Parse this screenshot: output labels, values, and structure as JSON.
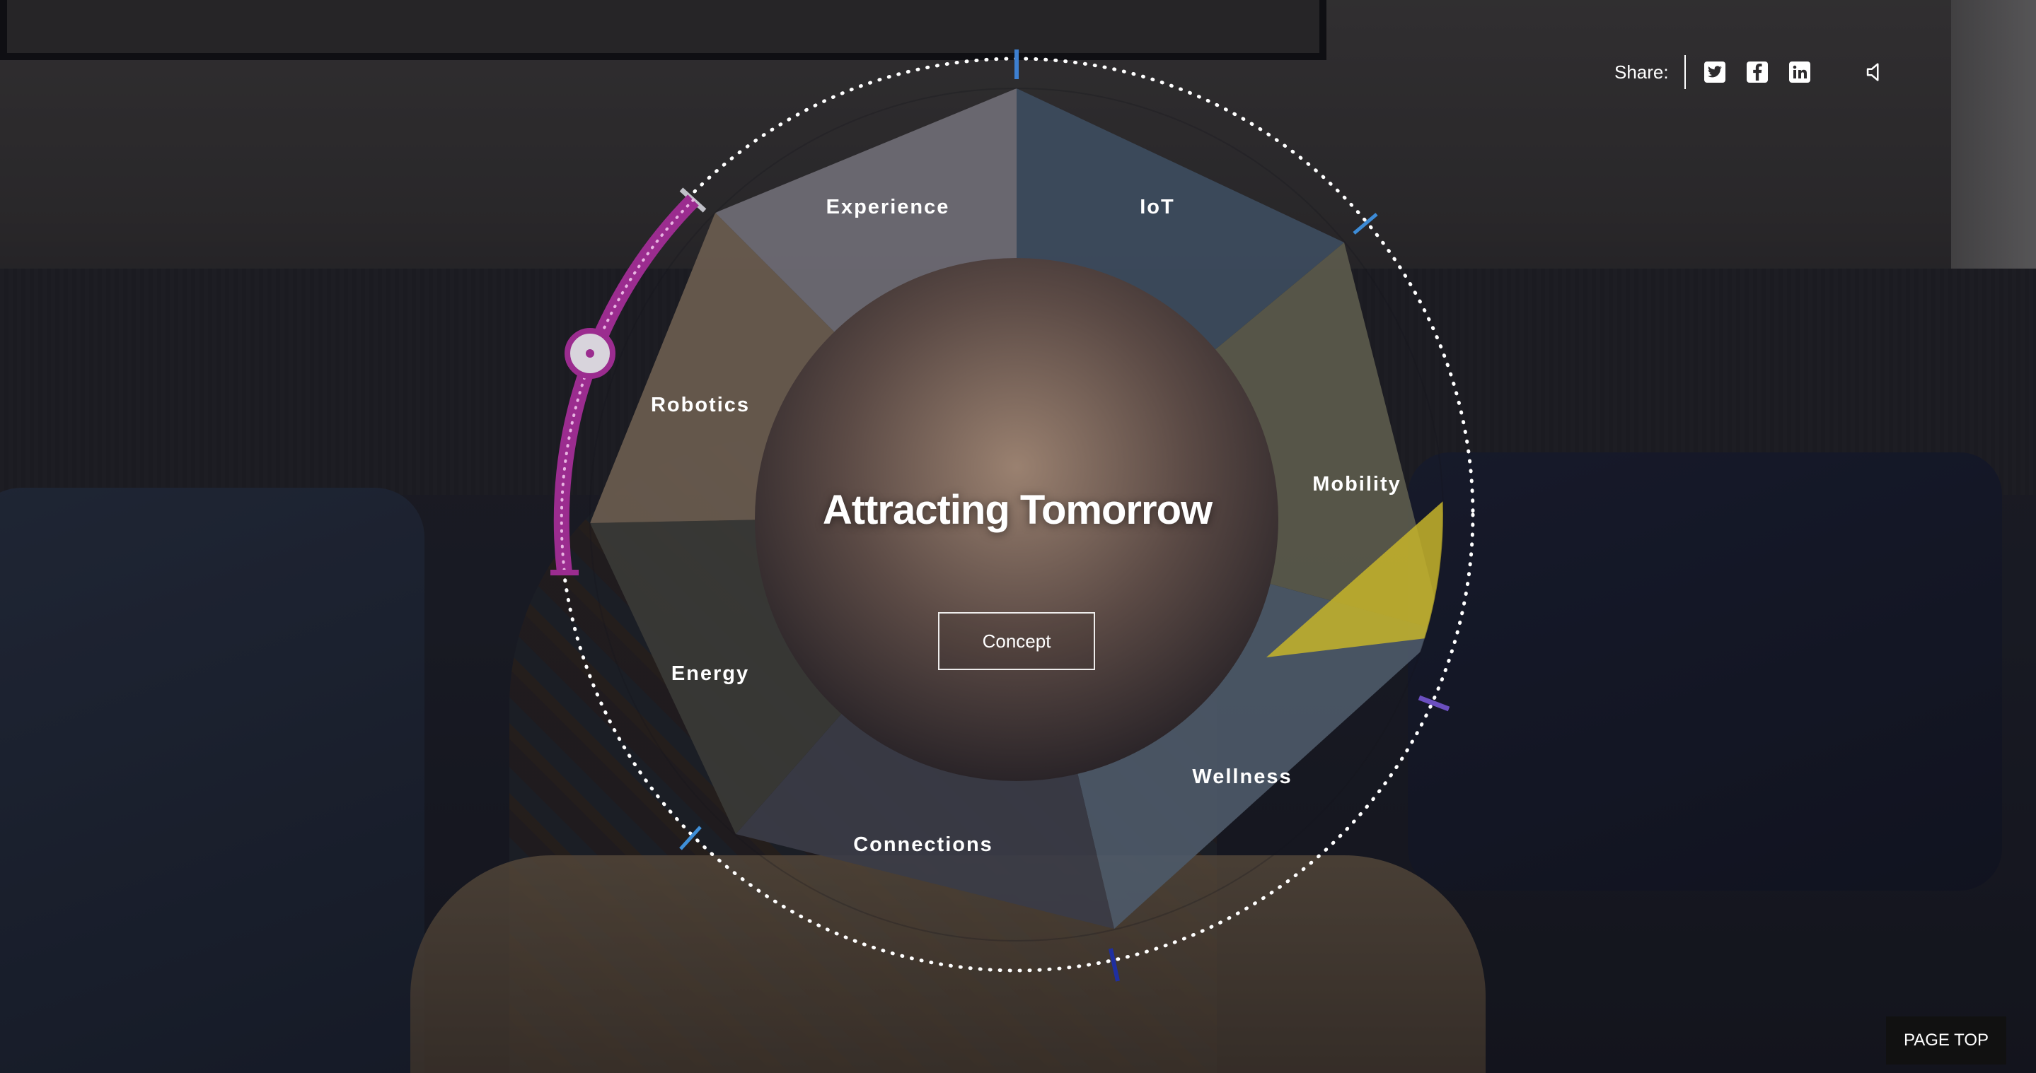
{
  "share": {
    "label": "Share:",
    "icons": [
      "twitter-icon",
      "facebook-icon",
      "linkedin-icon"
    ],
    "sound_icon": "speaker-icon"
  },
  "wheel": {
    "title": "Attracting Tomorrow",
    "concept_label": "Concept",
    "segments": [
      {
        "label": "Experience"
      },
      {
        "label": "IoT"
      },
      {
        "label": "Mobility"
      },
      {
        "label": "Wellness"
      },
      {
        "label": "Connections"
      },
      {
        "label": "Energy"
      },
      {
        "label": "Robotics"
      }
    ],
    "accent_color": "#9b2c8f",
    "tick_colors": [
      "#3d7fd0",
      "#3d8bd6",
      "#6b4fbf",
      "#1f2fa0",
      "#3f8fd8",
      "#c0c0c8"
    ]
  },
  "page_top_label": "PAGE TOP"
}
